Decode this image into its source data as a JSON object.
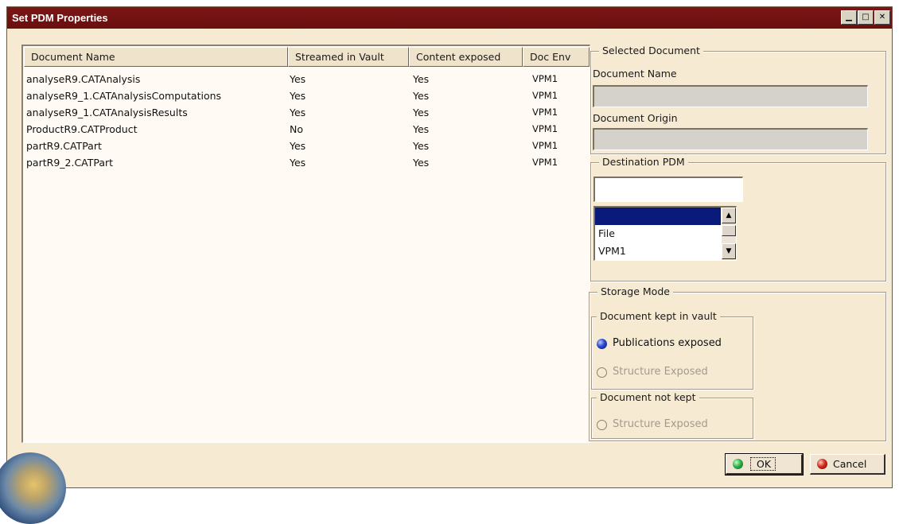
{
  "window": {
    "title": "Set PDM Properties",
    "controls": {
      "minimize": "▁",
      "maximize": "□",
      "close": "✕"
    }
  },
  "table": {
    "columns": [
      "Document Name",
      "Streamed in Vault",
      "Content exposed",
      "Doc Env"
    ],
    "rows": [
      [
        "analyseR9.CATAnalysis",
        "Yes",
        "Yes",
        "VPM1"
      ],
      [
        "analyseR9_1.CATAnalysisComputations",
        "Yes",
        "Yes",
        "VPM1"
      ],
      [
        "analyseR9_1.CATAnalysisResults",
        "Yes",
        "Yes",
        "VPM1"
      ],
      [
        "ProductR9.CATProduct",
        "No",
        "Yes",
        "VPM1"
      ],
      [
        "partR9.CATPart",
        "Yes",
        "Yes",
        "VPM1"
      ],
      [
        "partR9_2.CATPart",
        "Yes",
        "Yes",
        "VPM1"
      ]
    ]
  },
  "selected_document": {
    "group_label": "Selected Document",
    "name_label": "Document Name",
    "name_value": "",
    "origin_label": "Document Origin",
    "origin_value": ""
  },
  "destination_pdm": {
    "group_label": "Destination PDM",
    "input_value": "",
    "options": [
      "",
      "File",
      "VPM1"
    ],
    "selected_index": 0
  },
  "storage_mode": {
    "group_label": "Storage Mode",
    "kept_group_label": "Document kept in vault",
    "publications_exposed": "Publications exposed",
    "structure_exposed": "Structure Exposed",
    "not_kept_group_label": "Document not kept",
    "structure_exposed_not_kept": "Structure Exposed"
  },
  "buttons": {
    "ok": "OK",
    "cancel": "Cancel"
  },
  "colors": {
    "titlebar": "#7d1616",
    "dialog_bg": "#f6ead3",
    "selection": "#0a1a7a",
    "ok_dot": "#2fb24a",
    "cancel_dot": "#d42a1f"
  }
}
